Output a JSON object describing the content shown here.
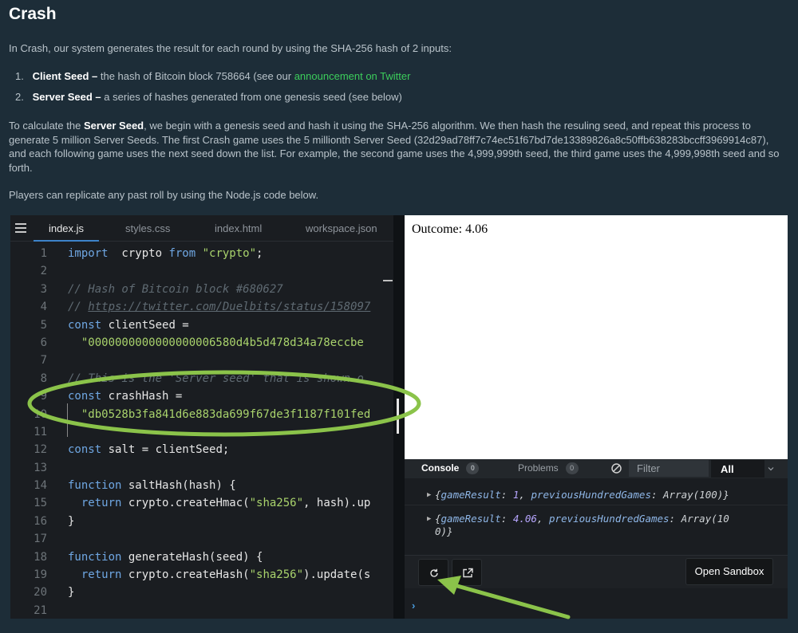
{
  "page": {
    "title": "Crash",
    "intro": "In Crash, our system generates the result for each round by using the SHA-256 hash of 2 inputs:",
    "list": [
      {
        "num": "1.",
        "term": "Client Seed –",
        "text": " the hash of Bitcoin block 758664 (see our ",
        "link": "announcement on Twitter"
      },
      {
        "num": "2.",
        "term": "Server Seed –",
        "text": " a series of hashes generated from one genesis seed (see below)"
      }
    ],
    "para2_a": "To calculate the ",
    "para2_b": "Server Seed",
    "para2_c": ", we begin with a genesis seed and hash it using the SHA-256 algorithm. We then hash the resuling seed, and repeat this process to generate 5 million Server Seeds. The first Crash game uses the 5 millionth Server Seed (32d29ad78ff7c74ec51f67bd7de13389826a8c50ffb638283bccff3969914c87), and each following game uses the next seed down the list. For example, the second game uses the 4,999,999th seed, the third game uses the 4,999,998th seed and so forth.",
    "para3": "Players can replicate any past roll by using the Node.js code below."
  },
  "editor": {
    "tabs": [
      "index.js",
      "styles.css",
      "index.html",
      "workspace.json"
    ],
    "active_tab": "index.js",
    "lines": [
      {
        "n": "1",
        "parts": [
          [
            "kw",
            "import"
          ],
          [
            "",
            "  crypto "
          ],
          [
            "kw",
            "from"
          ],
          [
            "",
            " "
          ],
          [
            "str",
            "\"crypto\""
          ],
          [
            "",
            ";"
          ]
        ]
      },
      {
        "n": "2",
        "parts": []
      },
      {
        "n": "3",
        "parts": [
          [
            "cm",
            "// Hash of Bitcoin block #680627"
          ]
        ]
      },
      {
        "n": "4",
        "parts": [
          [
            "cm",
            "// "
          ],
          [
            "cm url",
            "https://twitter.com/Duelbits/status/158097"
          ]
        ]
      },
      {
        "n": "5",
        "parts": [
          [
            "kw",
            "const"
          ],
          [
            "",
            " clientSeed ="
          ]
        ]
      },
      {
        "n": "6",
        "parts": [
          [
            "",
            "  "
          ],
          [
            "str",
            "\"0000000000000000006580d4b5d478d34a78eccbe"
          ]
        ]
      },
      {
        "n": "7",
        "parts": []
      },
      {
        "n": "8",
        "parts": [
          [
            "cm",
            "// This is the 'Server seed' that is shown o"
          ]
        ]
      },
      {
        "n": "9",
        "parts": [
          [
            "kw",
            "const"
          ],
          [
            "",
            " crashHash ="
          ]
        ]
      },
      {
        "n": "10",
        "parts": [
          [
            "",
            "  "
          ],
          [
            "str",
            "\"db0528b3fa841d6e883da699f67de3f1187f101fed"
          ]
        ]
      },
      {
        "n": "11",
        "parts": []
      },
      {
        "n": "12",
        "parts": [
          [
            "kw",
            "const"
          ],
          [
            "",
            " salt = clientSeed;"
          ]
        ]
      },
      {
        "n": "13",
        "parts": []
      },
      {
        "n": "14",
        "parts": [
          [
            "kw",
            "function"
          ],
          [
            "",
            " saltHash(hash) {"
          ]
        ]
      },
      {
        "n": "15",
        "parts": [
          [
            "",
            "  "
          ],
          [
            "kw",
            "return"
          ],
          [
            "",
            " crypto.createHmac("
          ],
          [
            "str",
            "\"sha256\""
          ],
          [
            "",
            ", hash).up"
          ]
        ]
      },
      {
        "n": "16",
        "parts": [
          [
            "",
            "}"
          ]
        ]
      },
      {
        "n": "17",
        "parts": []
      },
      {
        "n": "18",
        "parts": [
          [
            "kw",
            "function"
          ],
          [
            "",
            " generateHash(seed) {"
          ]
        ]
      },
      {
        "n": "19",
        "parts": [
          [
            "",
            "  "
          ],
          [
            "kw",
            "return"
          ],
          [
            "",
            " crypto.createHash("
          ],
          [
            "str",
            "\"sha256\""
          ],
          [
            "",
            ").update(s"
          ]
        ]
      },
      {
        "n": "20",
        "parts": [
          [
            "",
            "}"
          ]
        ]
      },
      {
        "n": "21",
        "parts": []
      }
    ]
  },
  "preview": {
    "outcome": "Outcome: 4.06"
  },
  "console": {
    "tab_console": "Console",
    "tab_problems": "Problems",
    "console_count": "0",
    "problems_count": "0",
    "filter_placeholder": "Filter",
    "level": "All",
    "logs": [
      {
        "open": "{",
        "k1": "gameResult",
        "v1": "1",
        "k2": "previousHundredGames",
        "v2": "Array(100)",
        "close": "}"
      },
      {
        "open": "{",
        "k1": "gameResult",
        "v1": "4.06",
        "k2": "previousHundredGames",
        "v2": "Array(10",
        "wrap": "0)}"
      }
    ],
    "open_sandbox": "Open Sandbox",
    "prompt": "›"
  },
  "colors": {
    "page_bg": "#1d2d38",
    "link": "#3ccd5b",
    "annotation": "#8bc34a",
    "keyword": "#6fa7e3",
    "string": "#a9d36c"
  }
}
